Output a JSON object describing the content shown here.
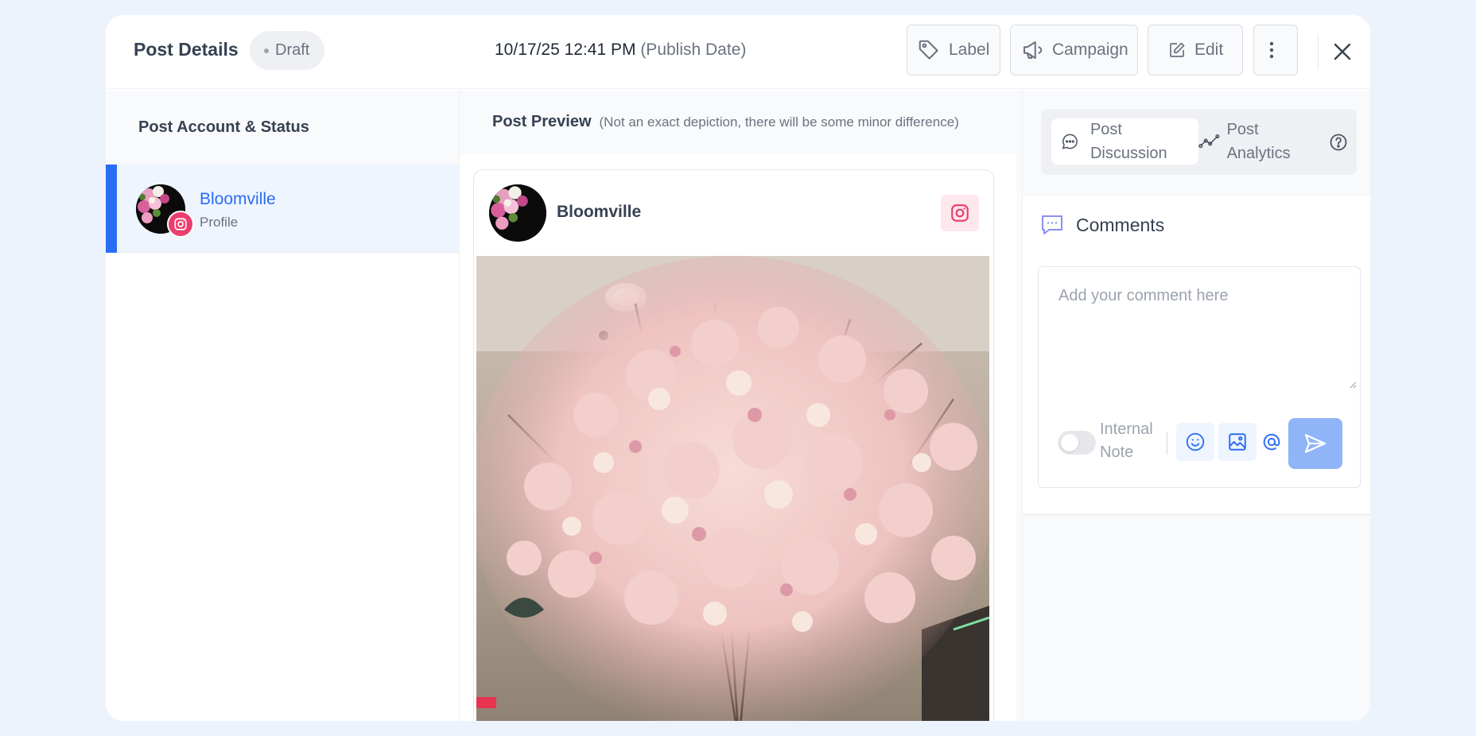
{
  "header": {
    "title": "Post Details",
    "status_badge": "Draft",
    "publish_datetime": "10/17/25 12:41 PM",
    "publish_label": "(Publish Date)",
    "buttons": {
      "label": "Label",
      "campaign": "Campaign",
      "edit": "Edit"
    },
    "icons": [
      "tag-icon",
      "megaphone-icon",
      "edit-icon",
      "more-vertical-icon",
      "close-icon"
    ]
  },
  "accounts_panel": {
    "heading": "Post Account & Status",
    "accounts": [
      {
        "name": "Bloomville",
        "type": "Profile",
        "platform": "instagram",
        "selected": true
      }
    ]
  },
  "preview": {
    "heading": "Post Preview",
    "note": "(Not an exact depiction, there will be some minor difference)",
    "card": {
      "account_name": "Bloomville",
      "platform_icon": "instagram-icon",
      "image_subject": "cherry-blossom-photo"
    }
  },
  "right_panel": {
    "tabs": [
      {
        "label": "Post Discussion",
        "active": true,
        "icon": "chat-bubble-icon"
      },
      {
        "label": "Post Analytics",
        "active": false,
        "icon": "analytics-line-icon"
      }
    ],
    "help_icon": "help-circle-icon",
    "comments": {
      "title": "Comments",
      "placeholder": "Add your comment here",
      "value": "",
      "internal_note_label": "Internal Note",
      "internal_note_on": false,
      "tools": [
        "emoji-icon",
        "image-icon",
        "at-mention-icon",
        "send-icon"
      ]
    }
  },
  "colors": {
    "accent": "#2b6cf5",
    "instagram": "#ec3e6d",
    "send_button": "#8fb4f8",
    "page_bg": "#edf3fc"
  }
}
